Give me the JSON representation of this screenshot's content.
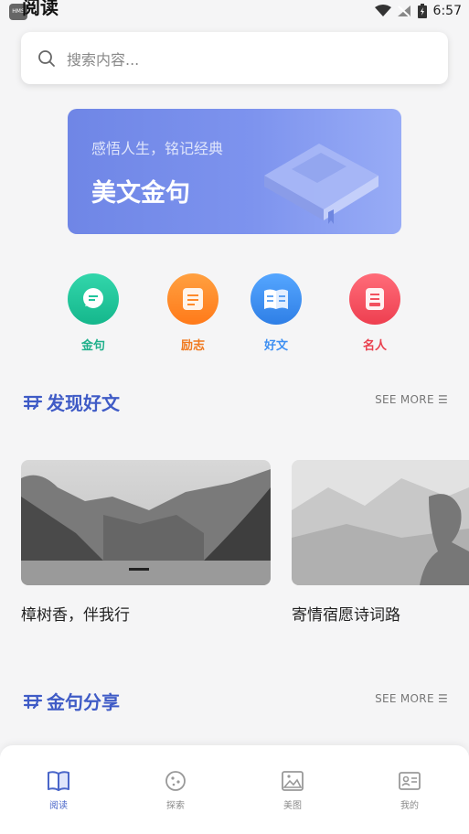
{
  "status_bar": {
    "title": "阅读",
    "time": "6:57",
    "hms_label": "HMS"
  },
  "search": {
    "placeholder": "搜索内容..."
  },
  "banner": {
    "subtitle": "感悟人生，铭记经典",
    "title": "美文金句"
  },
  "quick_actions": [
    {
      "label": "金句",
      "icon": "chat-bubble-icon",
      "color": "#1fc49b"
    },
    {
      "label": "励志",
      "icon": "note-card-icon",
      "color": "#ff8a2a"
    },
    {
      "label": "好文",
      "icon": "open-book-icon",
      "color": "#3d8ff2"
    },
    {
      "label": "名人",
      "icon": "document-icon",
      "color": "#f2505e"
    }
  ],
  "section_discover": {
    "title": "发现好文",
    "see_more": "SEE MORE ☰"
  },
  "articles": [
    {
      "title": "樟树香，伴我行"
    },
    {
      "title": "寄情宿愿诗词路"
    }
  ],
  "section_quotes": {
    "title": "金句分享",
    "see_more": "SEE MORE ☰"
  },
  "tabs": [
    {
      "label": "阅读",
      "icon": "book-icon",
      "active": true
    },
    {
      "label": "探索",
      "icon": "compass-icon",
      "active": false
    },
    {
      "label": "美图",
      "icon": "image-icon",
      "active": false
    },
    {
      "label": "我的",
      "icon": "profile-card-icon",
      "active": false
    }
  ],
  "colors": {
    "accent": "#3f5bc6",
    "background": "#f5f5f6"
  }
}
